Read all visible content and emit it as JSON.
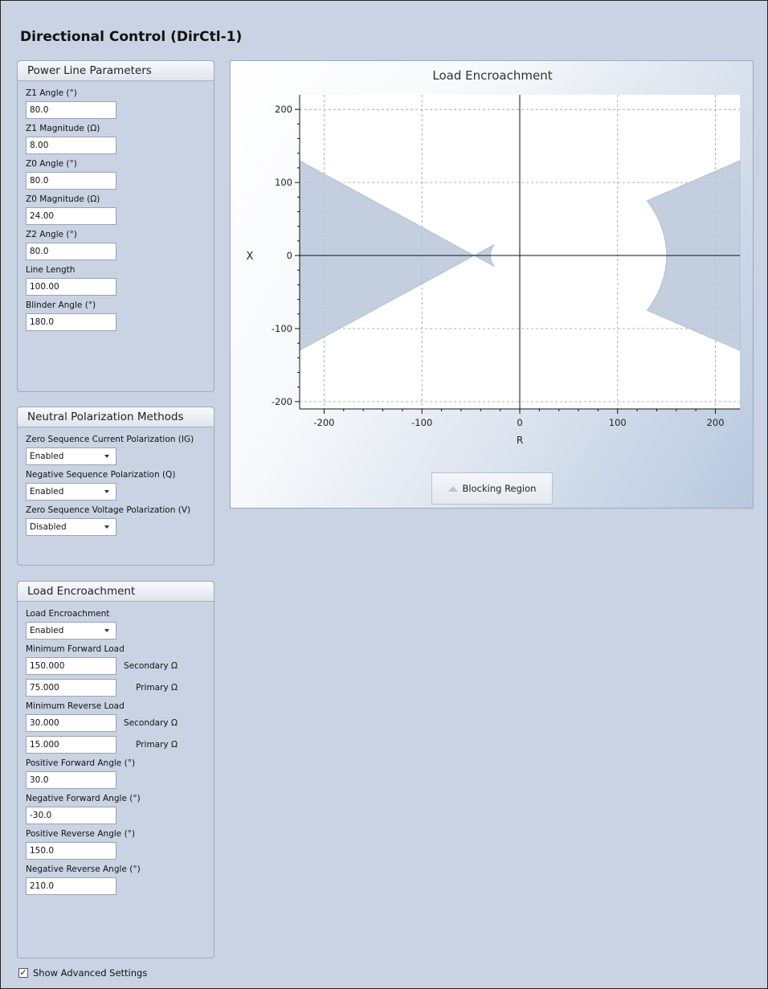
{
  "page": {
    "title": "Directional Control (DirCtl-1)"
  },
  "power_line": {
    "header": "Power Line Parameters",
    "fields": [
      {
        "label": "Z1 Angle (°)",
        "value": "80.0"
      },
      {
        "label": "Z1 Magnitude (Ω)",
        "value": "8.00"
      },
      {
        "label": "Z0 Angle (°)",
        "value": "80.0"
      },
      {
        "label": "Z0 Magnitude (Ω)",
        "value": "24.00"
      },
      {
        "label": "Z2 Angle (°)",
        "value": "80.0"
      },
      {
        "label": "Line Length",
        "value": "100.00"
      },
      {
        "label": "Blinder Angle (°)",
        "value": "180.0"
      }
    ]
  },
  "neutral": {
    "header": "Neutral Polarization Methods",
    "fields": [
      {
        "label": "Zero Sequence Current Polarization (IG)",
        "value": "Enabled"
      },
      {
        "label": "Negative Sequence Polarization (Q)",
        "value": "Enabled"
      },
      {
        "label": "Zero Sequence Voltage Polarization (V)",
        "value": "Disabled"
      }
    ]
  },
  "load": {
    "header": "Load Encroachment",
    "le_label": "Load Encroachment",
    "le_value": "Enabled",
    "min_fwd_label": "Minimum Forward Load",
    "min_fwd_secondary": "150.000",
    "min_fwd_primary": "75.000",
    "min_rev_label": "Minimum Reverse Load",
    "min_rev_secondary": "30.000",
    "min_rev_primary": "15.000",
    "secondary_unit": "Secondary Ω",
    "primary_unit": "Primary Ω",
    "angles": [
      {
        "label": "Positive Forward Angle (°)",
        "value": "30.0"
      },
      {
        "label": "Negative Forward Angle (°)",
        "value": "-30.0"
      },
      {
        "label": "Positive Reverse Angle (°)",
        "value": "150.0"
      },
      {
        "label": "Negative Reverse Angle (°)",
        "value": "210.0"
      }
    ]
  },
  "advanced": {
    "label": "Show Advanced Settings",
    "checked": true,
    "mark": "✓"
  },
  "chart_data": {
    "type": "area",
    "title": "Load Encroachment",
    "xlabel": "R",
    "ylabel": "X",
    "xlim": [
      -225,
      225
    ],
    "ylim": [
      -210,
      220
    ],
    "xticks": [
      -200,
      -100,
      0,
      100,
      200
    ],
    "yticks": [
      -200,
      -100,
      0,
      100,
      200
    ],
    "grid": true,
    "legend": "bottom-center",
    "fill_color": "#b9c6d9",
    "series": [
      {
        "name": "Blocking Region",
        "forward": {
          "radius": 150,
          "angle_pos": 30,
          "angle_neg": -30
        },
        "reverse": {
          "radius": 30,
          "angle_pos": 150,
          "angle_neg": 210
        }
      }
    ]
  }
}
